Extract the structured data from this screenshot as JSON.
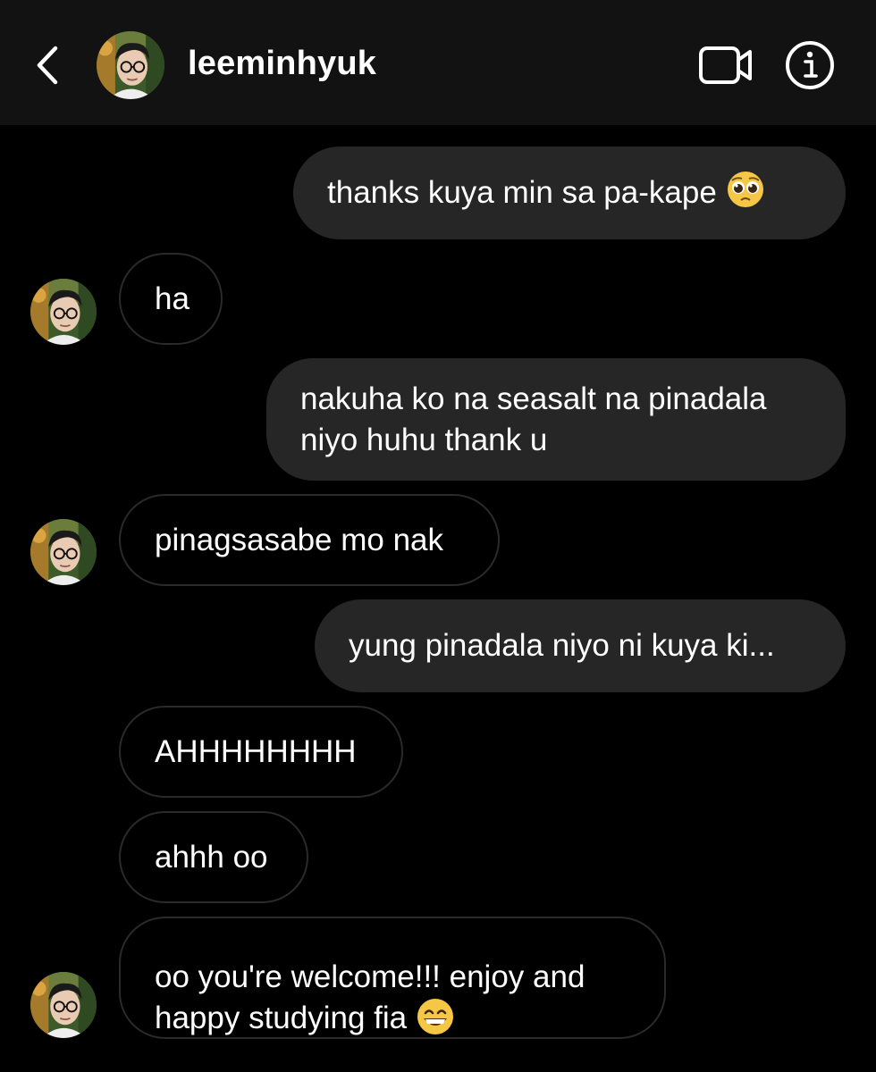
{
  "header": {
    "username": "leeminhyuk",
    "back_icon": "chevron-left-icon",
    "video_icon": "video-camera-icon",
    "info_icon": "info-icon"
  },
  "colors": {
    "background": "#000000",
    "header_bg": "#121212",
    "outgoing_bubble": "#262626",
    "incoming_border": "#2a2a2a",
    "text": "#ffffff"
  },
  "messages": [
    {
      "direction": "outgoing",
      "text": "thanks kuya min sa pa-kape",
      "emoji": "pleading-face-emoji"
    },
    {
      "direction": "incoming",
      "text": "ha"
    },
    {
      "direction": "outgoing",
      "text": "nakuha ko na seasalt na pinadala\nniyo huhu thank u"
    },
    {
      "direction": "incoming",
      "text": "pinagsasabe mo nak"
    },
    {
      "direction": "outgoing",
      "text": "yung pinadala niyo ni kuya ki..."
    },
    {
      "direction": "incoming",
      "text": "AHHHHHHHH"
    },
    {
      "direction": "incoming",
      "text": "ahhh oo"
    },
    {
      "direction": "incoming",
      "text": "oo you're welcome!!! enjoy and\nhappy studying fia",
      "emoji": "grinning-face-emoji"
    }
  ]
}
